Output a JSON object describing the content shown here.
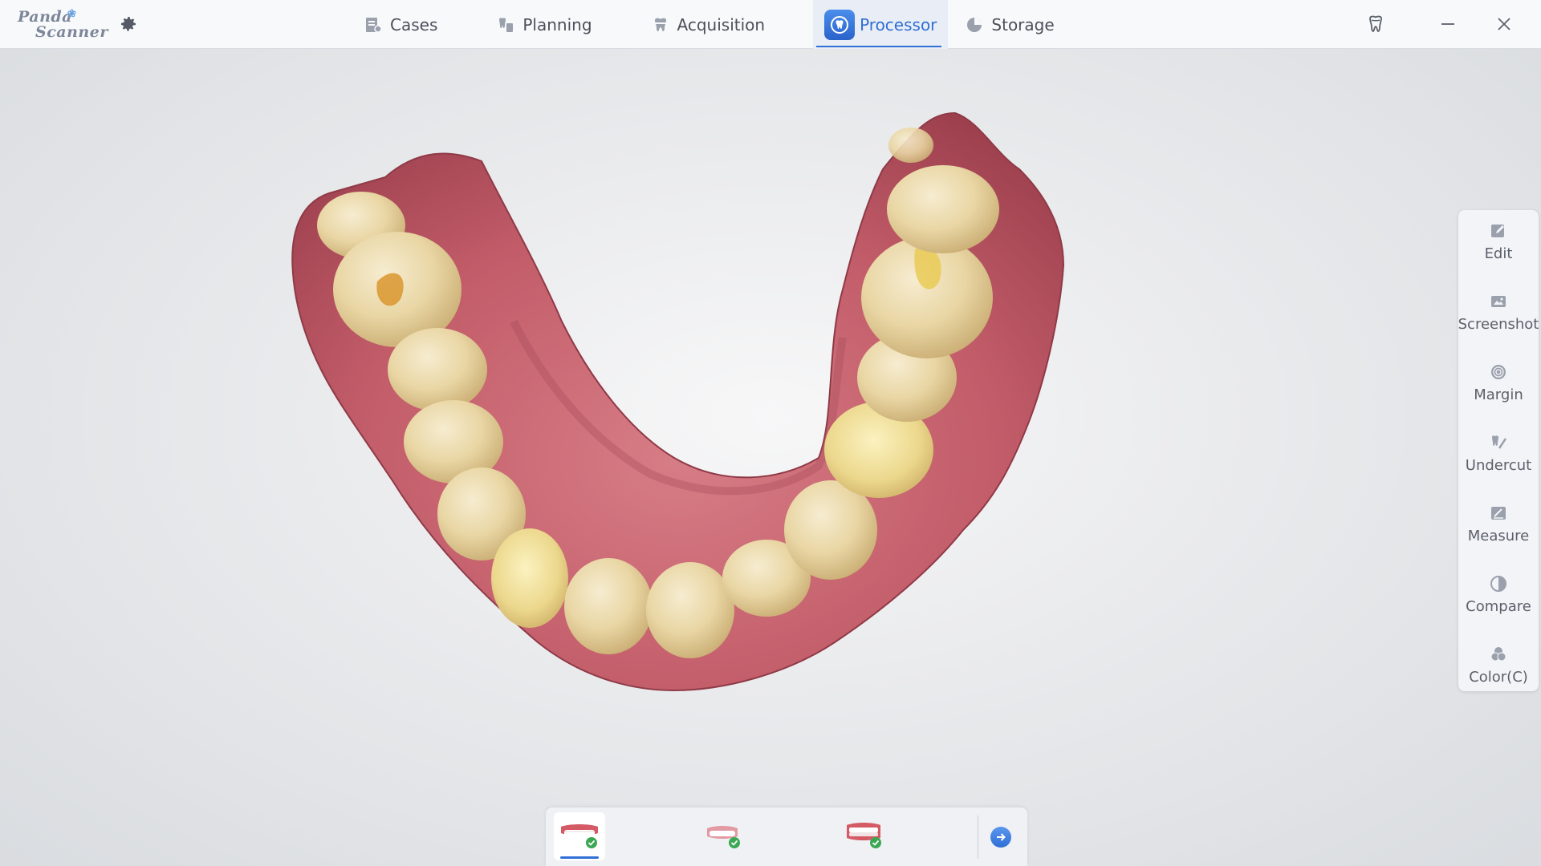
{
  "app": {
    "logo_line1": "Panda",
    "logo_line2": "Scanner",
    "settings_icon": "gear-icon"
  },
  "nav": {
    "items": [
      {
        "label": "Cases",
        "icon": "cases-icon"
      },
      {
        "label": "Planning",
        "icon": "planning-icon"
      },
      {
        "label": "Acquisition",
        "icon": "acquisition-icon"
      },
      {
        "label": "Processor",
        "icon": "processor-icon",
        "active": true
      },
      {
        "label": "Storage",
        "icon": "storage-icon"
      }
    ]
  },
  "window": {
    "tooth_icon": "tooth-icon",
    "minimize_icon": "minimize-icon",
    "close_icon": "close-icon"
  },
  "tools": {
    "items": [
      {
        "label": "Edit",
        "icon": "edit-icon"
      },
      {
        "label": "Screenshot",
        "icon": "screenshot-icon"
      },
      {
        "label": "Margin",
        "icon": "margin-icon"
      },
      {
        "label": "Undercut",
        "icon": "undercut-icon"
      },
      {
        "label": "Measure",
        "icon": "measure-icon"
      },
      {
        "label": "Compare",
        "icon": "compare-icon"
      },
      {
        "label": "Color(C)",
        "icon": "color-icon"
      }
    ]
  },
  "bottom": {
    "scans": [
      {
        "name": "upper-jaw",
        "status": "complete",
        "active": true
      },
      {
        "name": "lower-jaw",
        "status": "complete"
      },
      {
        "name": "bite",
        "status": "complete"
      }
    ],
    "next_icon": "arrow-right-icon"
  },
  "colors": {
    "accent": "#2f6fd6",
    "gum": "#c4606c",
    "tooth": "#ecd9a8",
    "check": "#3aa853"
  }
}
